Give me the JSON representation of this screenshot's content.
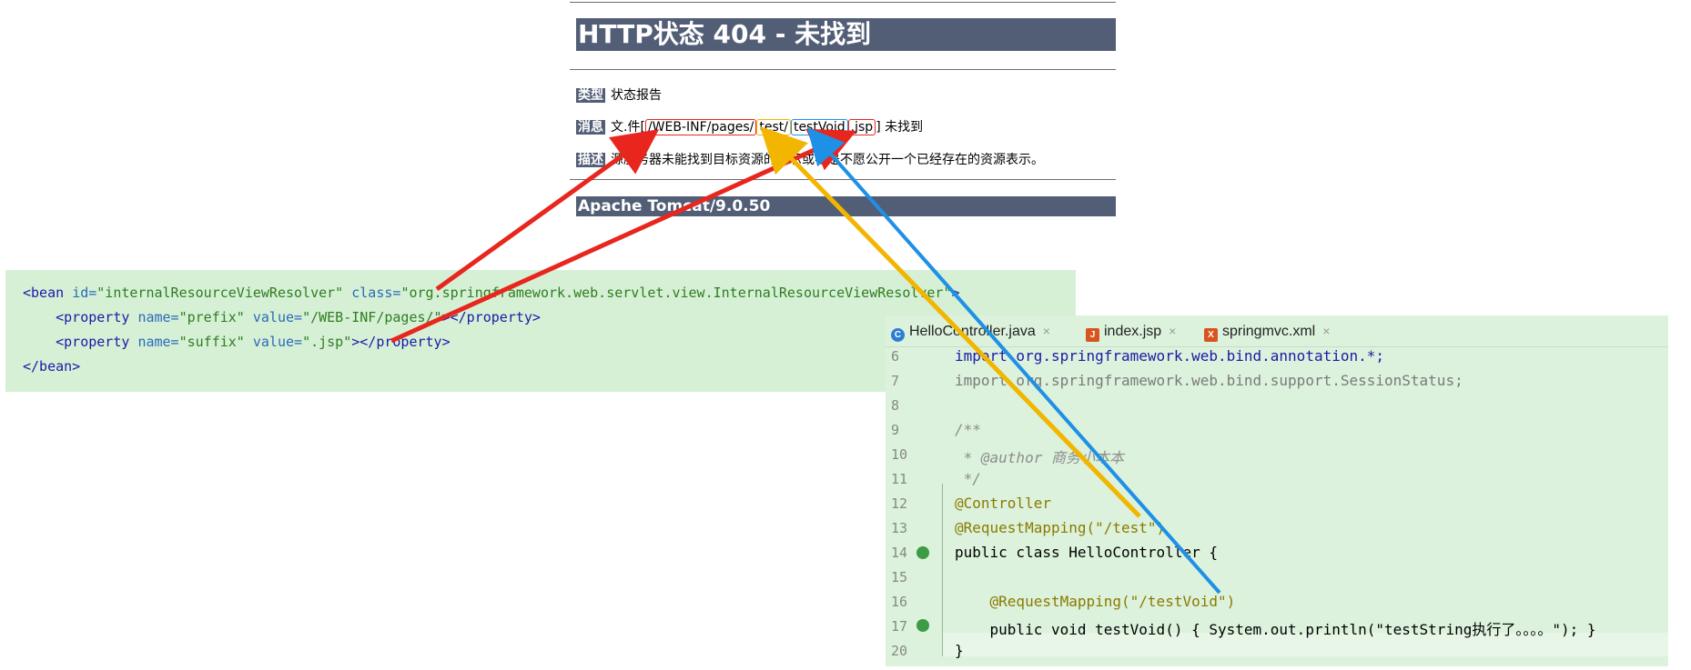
{
  "tomcat": {
    "title": "HTTP状态 404 - 未找到",
    "type_label": "类型",
    "type_value": "状态报告",
    "message_label": "消息",
    "message_prefix": "文.件[",
    "message_parts": [
      "/WEB-INF/pages/",
      "test/",
      "testVoid",
      ".jsp"
    ],
    "message_suffix": "] 未找到",
    "desc_label": "描述",
    "desc_value": "源服务器未能找到目标资源的表示或者是不愿公开一个已经存在的资源表示。",
    "footer": "Apache Tomcat/9.0.50"
  },
  "xml": {
    "line1": {
      "open": "<bean ",
      "id_attr": "id=",
      "id_val": "\"internalResourceViewResolver\"",
      "class_attr": " class=",
      "class_val": "\"org.springframework.web.servlet.view.InternalResourceViewResolver\"",
      "close": ">"
    },
    "line2": {
      "open": "    <property ",
      "name_attr": "name=",
      "name_val": "\"prefix\"",
      "value_attr": " value=",
      "value_val": "\"/WEB-INF/pages/\"",
      "close": "></property>"
    },
    "line3": {
      "open": "    <property ",
      "name_attr": "name=",
      "name_val": "\"suffix\"",
      "value_attr": " value=",
      "value_val": "\".jsp\"",
      "close": "></property>"
    },
    "line4": "</bean>"
  },
  "ide": {
    "tabs": [
      {
        "label": "HelloController.java",
        "icon": "java-class-icon",
        "color": "#2a7fd4"
      },
      {
        "label": "index.jsp",
        "icon": "jsp-file-icon",
        "color": "#d9531e"
      },
      {
        "label": "springmvc.xml",
        "icon": "xml-file-icon",
        "color": "#d9531e"
      }
    ],
    "close_glyph": "×",
    "lines": [
      {
        "num": "6",
        "code": "import org.springframework.web.bind.annotation.*;"
      },
      {
        "num": "7",
        "code": "import org.springframework.web.bind.support.SessionStatus;"
      },
      {
        "num": "8",
        "code": ""
      },
      {
        "num": "9",
        "code": "/**"
      },
      {
        "num": "10",
        "code": " * @author 商务小本本"
      },
      {
        "num": "11",
        "code": " */"
      },
      {
        "num": "12",
        "code": "@Controller"
      },
      {
        "num": "13",
        "code": "@RequestMapping(\"/test\")"
      },
      {
        "num": "14",
        "code": "public class HelloController {"
      },
      {
        "num": "15",
        "code": ""
      },
      {
        "num": "16",
        "code": "    @RequestMapping(\"/testVoid\")"
      },
      {
        "num": "17",
        "code": "    public void testVoid() { System.out.println(\"testString执行了。。。。\"); }"
      },
      {
        "num": "20",
        "code": "}"
      }
    ]
  },
  "colors": {
    "tomcat_bar": "#525d76",
    "red_arrow": "#e8261d",
    "yellow_arrow": "#f2b500",
    "blue_arrow": "#1e90e6",
    "panel_green": "#d6f0d6"
  }
}
